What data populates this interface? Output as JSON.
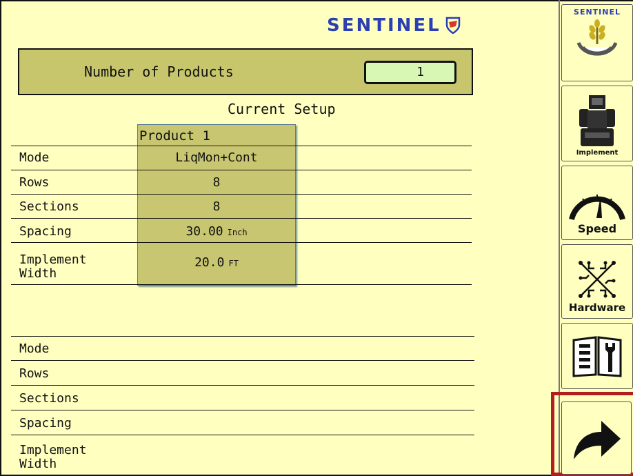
{
  "header": {
    "logo_text": "SENTINEL"
  },
  "products": {
    "label": "Number of Products",
    "value": "1"
  },
  "setup": {
    "title": "Current Setup",
    "product_title": "Product 1"
  },
  "rows": [
    {
      "label": "Mode",
      "value": "LiqMon+Cont",
      "unit": ""
    },
    {
      "label": "Rows",
      "value": "8",
      "unit": ""
    },
    {
      "label": "Sections",
      "value": "8",
      "unit": ""
    },
    {
      "label": "Spacing",
      "value": "30.00",
      "unit": "Inch"
    },
    {
      "label_line1": "Implement",
      "label_line2": "Width",
      "value": "20.0",
      "unit": "FT"
    }
  ],
  "rows2": [
    {
      "label": "Mode"
    },
    {
      "label": "Rows"
    },
    {
      "label": "Sections"
    },
    {
      "label": "Spacing"
    },
    {
      "label_line1": "Implement",
      "label_line2": "Width"
    }
  ],
  "sidebar": {
    "brand": "SENTINEL",
    "implement": "Implement",
    "speed": "Speed",
    "hardware": "Hardware"
  },
  "colors": {
    "background": "#ffffc0",
    "panel": "#c8c66c",
    "input": "#d9f7b4",
    "logo": "#2a3fb4",
    "highlight": "#b01e1e"
  }
}
